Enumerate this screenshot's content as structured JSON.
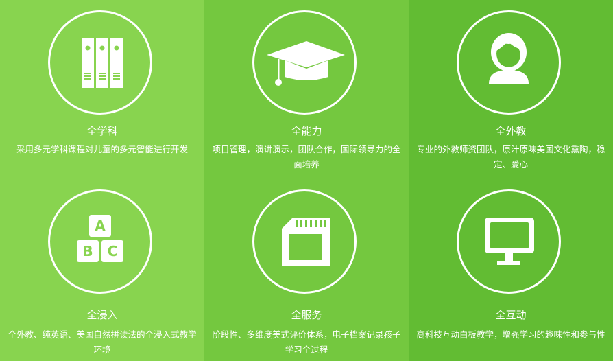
{
  "features": [
    {
      "title": "全学科",
      "desc": "采用多元学科课程对儿童的多元智能进行开发",
      "icon": "books-icon"
    },
    {
      "title": "全能力",
      "desc": "项目管理，演讲演示，团队合作，国际领导力的全面培养",
      "icon": "graduation-cap-icon"
    },
    {
      "title": "全外教",
      "desc": "专业的外教师资团队，原汁原味美国文化熏陶，稳定、爱心",
      "icon": "teacher-avatar-icon"
    },
    {
      "title": "全浸入",
      "desc": "全外教、纯英语、美国自然拼读法的全浸入式教学环境",
      "icon": "abc-blocks-icon",
      "block_letters": [
        "A",
        "B",
        "C"
      ]
    },
    {
      "title": "全服务",
      "desc": "阶段性、多维度美式评价体系，电子档案记录孩子学习全过程",
      "icon": "sd-card-icon"
    },
    {
      "title": "全互动",
      "desc": "高科技互动白板教学，增强学习的趣味性和参与性",
      "icon": "monitor-icon"
    }
  ],
  "colors": {
    "col1_bg": "#88d44f",
    "col2_bg": "#74c83f",
    "col3_bg": "#62bc33",
    "foreground": "#ffffff"
  }
}
